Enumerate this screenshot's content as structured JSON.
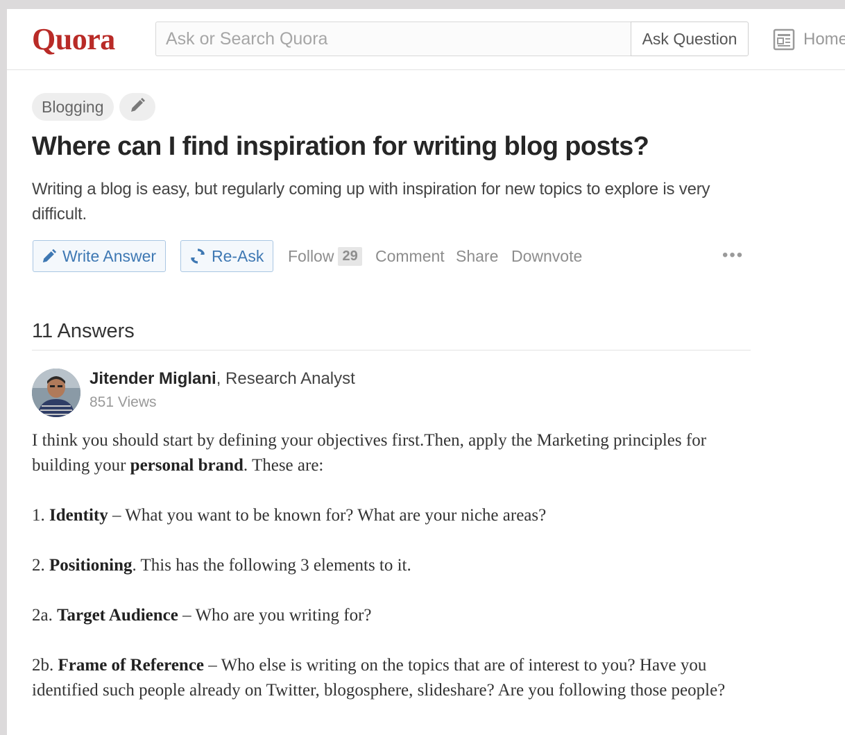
{
  "header": {
    "logo": "Quora",
    "search_placeholder": "Ask or Search Quora",
    "ask_button": "Ask Question",
    "home_label": "Home"
  },
  "question": {
    "topic": "Blogging",
    "title": "Where can I find inspiration for writing blog posts?",
    "details": "Writing a blog is easy, but regularly coming up with inspiration for new topics to explore is very difficult.",
    "actions": {
      "write_answer": "Write Answer",
      "reask": "Re-Ask",
      "follow": "Follow",
      "follow_count": "29",
      "comment": "Comment",
      "share": "Share",
      "downvote": "Downvote",
      "more": "•••"
    }
  },
  "answers": {
    "count_label": "11 Answers",
    "items": [
      {
        "author_name": "Jitender Miglani",
        "author_title": ", Research Analyst",
        "views": "851 Views",
        "paragraphs": [
          {
            "pre": "I think you should start by defining your objectives first.Then, apply the Marketing principles for building your ",
            "bold": "personal brand",
            "post": ". These are:"
          },
          {
            "pre": "1. ",
            "bold": "Identity",
            "post": " – What you want to be known for? What are your niche areas?"
          },
          {
            "pre": "2. ",
            "bold": "Positioning",
            "post": ". This has the following 3 elements to it."
          },
          {
            "pre": "2a. ",
            "bold": "Target Audience",
            "post": " – Who are you writing for?"
          },
          {
            "pre": "2b. ",
            "bold": "Frame of Reference",
            "post": " – Who else is writing on the topics that are of interest to you? Have you identified such people already on Twitter, blogosphere, slideshare? Are you following those people?"
          }
        ]
      }
    ]
  },
  "colors": {
    "brand": "#b92b27",
    "link_blue": "#3e78b3",
    "muted": "#8d8d8d",
    "background": "#dcdadb"
  },
  "icons": {
    "home": "newspaper-icon",
    "write": "pencil-icon",
    "reask": "refresh-icon",
    "edit_topic": "pencil-icon"
  }
}
